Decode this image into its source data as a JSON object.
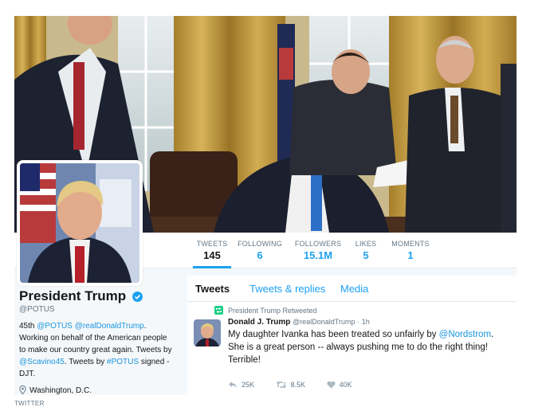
{
  "nav": {
    "tweets": {
      "label": "TWEETS",
      "value": "145"
    },
    "following": {
      "label": "FOLLOWING",
      "value": "6"
    },
    "followers": {
      "label": "FOLLOWERS",
      "value": "15.1M"
    },
    "likes": {
      "label": "LIKES",
      "value": "5"
    },
    "moments": {
      "label": "MOMENTS",
      "value": "1"
    }
  },
  "profile": {
    "name": "President Trump",
    "handle": "@POTUS",
    "bio": {
      "p1": "45th ",
      "m1": "@POTUS",
      "p2": " ",
      "m2": "@realDonaldTrump",
      "p3": ". Working on behalf of the American people to make our country great again. Tweets by ",
      "m3": "@Scavino45",
      "p4": ". Tweets by ",
      "m4": "#POTUS",
      "p5": " signed -DJT."
    },
    "location": "Washington, D.C."
  },
  "tabs": {
    "tweets": "Tweets",
    "replies": "Tweets & replies",
    "media": "Media"
  },
  "tweet": {
    "retweeted_by": "President Trump Retweeted",
    "author_name": "Donald J. Trump",
    "author_handle": "@realDonaldTrump",
    "time": "· 1h",
    "text_before": "My daughter Ivanka has been treated so unfairly by ",
    "mention": "@Nordstrom",
    "text_after": ". She is a great person -- always pushing me to do the right thing! Terrible!",
    "reply_count": "25K",
    "retweet_count": "8.5K",
    "like_count": "40K"
  },
  "caption": "TWITTER",
  "colors": {
    "accent": "#1da1f2",
    "link": "#1b95e0",
    "retweet_green": "#19cf86",
    "muted": "#657786"
  },
  "icons": {
    "verified": "verified-badge-icon",
    "location": "location-pin-icon",
    "retweet": "retweet-icon",
    "reply": "reply-icon",
    "like": "heart-icon"
  }
}
